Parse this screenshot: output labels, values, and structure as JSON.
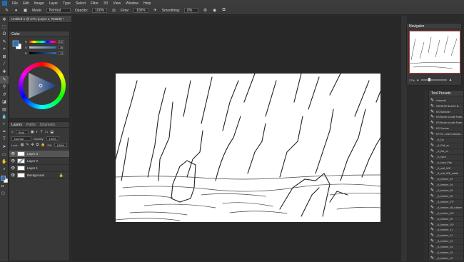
{
  "menubar": {
    "items": [
      "File",
      "Edit",
      "Image",
      "Layer",
      "Type",
      "Select",
      "Filter",
      "3D",
      "View",
      "Window",
      "Help"
    ]
  },
  "options": {
    "mode_label": "Mode:",
    "mode_value": "Normal",
    "opacity_label": "Opacity:",
    "opacity_value": "100%",
    "flow_label": "Flow:",
    "flow_value": "100%",
    "smoothing_label": "Smoothing:",
    "smoothing_value": "0%"
  },
  "document": {
    "tab_title": "Untitled-1 @ 27% (Layer 1, RGB/8) *"
  },
  "color_panel": {
    "tab": "Color",
    "sliders": [
      {
        "label": "H",
        "value": "210"
      },
      {
        "label": "S",
        "value": "38"
      },
      {
        "label": "B",
        "value": "73"
      }
    ],
    "fg_color": "#2f6fb3",
    "bg_color": "#ffffff"
  },
  "layers_panel": {
    "tabs": [
      "Layers",
      "Paths",
      "Channels"
    ],
    "kind_label": "Kind",
    "blend_mode": "Normal",
    "opacity_label": "Opacity:",
    "opacity_value": "100%",
    "lock_label": "Lock:",
    "fill_label": "Fill:",
    "fill_value": "100%",
    "layers": [
      {
        "name": "Layer 3",
        "selected": true
      },
      {
        "name": "Layer 2",
        "selected": false
      },
      {
        "name": "Layer 1",
        "selected": false
      },
      {
        "name": "Background",
        "selected": false
      }
    ]
  },
  "navigator": {
    "title": "Navigator",
    "zoom": "27%"
  },
  "tool_presets": {
    "title": "Tool Presets",
    "items": [
      "charcoal",
      "INFINITE BLACK B...",
      "KS Sketcher",
      "KS Brush to side Fram...",
      "KS Brush to side Fram...",
      "KS Canvas",
      "KYFS – AAS Canvas ...",
      "_A_Dx",
      "_A_Flat_xx",
      "_A_flat_xx",
      "_A_hard",
      "_A_hard_Flat",
      "_A_soft_WE",
      "_A_soft_WE_rotate",
      "_A_texture_03",
      "_A_texture_04",
      "_A_texture_05",
      "_A_texture_06",
      "_A_texture_07*",
      "_A_texture_08_rubber",
      "_A_texture_09*",
      "_A_texture_09",
      "_A_texture_10*",
      "_A_texture_11",
      "_A_texture_12",
      "_A_texture_13",
      "_A_texture_14",
      "_A_texture_15",
      "_A_texture_16"
    ]
  }
}
